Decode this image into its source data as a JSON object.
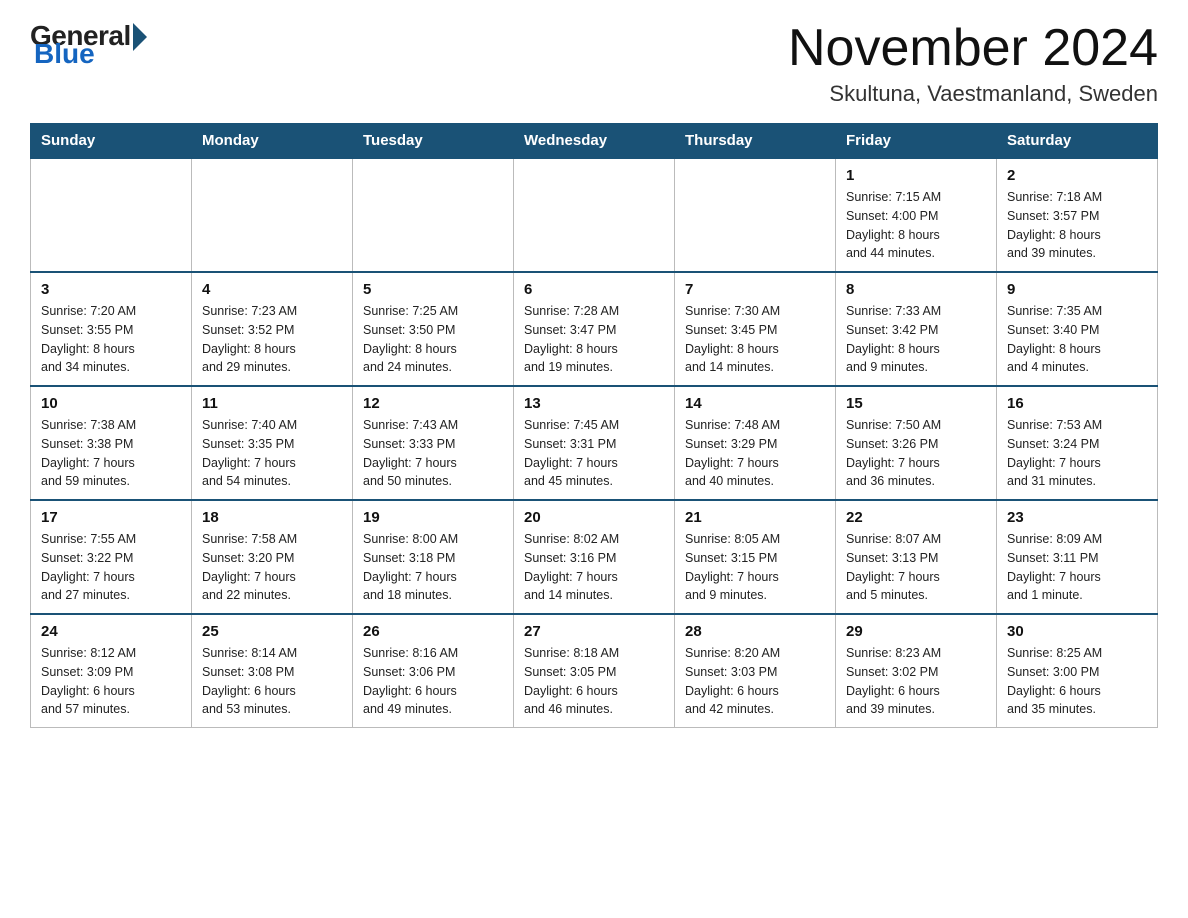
{
  "logo": {
    "general": "General",
    "blue": "Blue"
  },
  "title": "November 2024",
  "subtitle": "Skultuna, Vaestmanland, Sweden",
  "weekdays": [
    "Sunday",
    "Monday",
    "Tuesday",
    "Wednesday",
    "Thursday",
    "Friday",
    "Saturday"
  ],
  "weeks": [
    [
      {
        "day": "",
        "info": ""
      },
      {
        "day": "",
        "info": ""
      },
      {
        "day": "",
        "info": ""
      },
      {
        "day": "",
        "info": ""
      },
      {
        "day": "",
        "info": ""
      },
      {
        "day": "1",
        "info": "Sunrise: 7:15 AM\nSunset: 4:00 PM\nDaylight: 8 hours\nand 44 minutes."
      },
      {
        "day": "2",
        "info": "Sunrise: 7:18 AM\nSunset: 3:57 PM\nDaylight: 8 hours\nand 39 minutes."
      }
    ],
    [
      {
        "day": "3",
        "info": "Sunrise: 7:20 AM\nSunset: 3:55 PM\nDaylight: 8 hours\nand 34 minutes."
      },
      {
        "day": "4",
        "info": "Sunrise: 7:23 AM\nSunset: 3:52 PM\nDaylight: 8 hours\nand 29 minutes."
      },
      {
        "day": "5",
        "info": "Sunrise: 7:25 AM\nSunset: 3:50 PM\nDaylight: 8 hours\nand 24 minutes."
      },
      {
        "day": "6",
        "info": "Sunrise: 7:28 AM\nSunset: 3:47 PM\nDaylight: 8 hours\nand 19 minutes."
      },
      {
        "day": "7",
        "info": "Sunrise: 7:30 AM\nSunset: 3:45 PM\nDaylight: 8 hours\nand 14 minutes."
      },
      {
        "day": "8",
        "info": "Sunrise: 7:33 AM\nSunset: 3:42 PM\nDaylight: 8 hours\nand 9 minutes."
      },
      {
        "day": "9",
        "info": "Sunrise: 7:35 AM\nSunset: 3:40 PM\nDaylight: 8 hours\nand 4 minutes."
      }
    ],
    [
      {
        "day": "10",
        "info": "Sunrise: 7:38 AM\nSunset: 3:38 PM\nDaylight: 7 hours\nand 59 minutes."
      },
      {
        "day": "11",
        "info": "Sunrise: 7:40 AM\nSunset: 3:35 PM\nDaylight: 7 hours\nand 54 minutes."
      },
      {
        "day": "12",
        "info": "Sunrise: 7:43 AM\nSunset: 3:33 PM\nDaylight: 7 hours\nand 50 minutes."
      },
      {
        "day": "13",
        "info": "Sunrise: 7:45 AM\nSunset: 3:31 PM\nDaylight: 7 hours\nand 45 minutes."
      },
      {
        "day": "14",
        "info": "Sunrise: 7:48 AM\nSunset: 3:29 PM\nDaylight: 7 hours\nand 40 minutes."
      },
      {
        "day": "15",
        "info": "Sunrise: 7:50 AM\nSunset: 3:26 PM\nDaylight: 7 hours\nand 36 minutes."
      },
      {
        "day": "16",
        "info": "Sunrise: 7:53 AM\nSunset: 3:24 PM\nDaylight: 7 hours\nand 31 minutes."
      }
    ],
    [
      {
        "day": "17",
        "info": "Sunrise: 7:55 AM\nSunset: 3:22 PM\nDaylight: 7 hours\nand 27 minutes."
      },
      {
        "day": "18",
        "info": "Sunrise: 7:58 AM\nSunset: 3:20 PM\nDaylight: 7 hours\nand 22 minutes."
      },
      {
        "day": "19",
        "info": "Sunrise: 8:00 AM\nSunset: 3:18 PM\nDaylight: 7 hours\nand 18 minutes."
      },
      {
        "day": "20",
        "info": "Sunrise: 8:02 AM\nSunset: 3:16 PM\nDaylight: 7 hours\nand 14 minutes."
      },
      {
        "day": "21",
        "info": "Sunrise: 8:05 AM\nSunset: 3:15 PM\nDaylight: 7 hours\nand 9 minutes."
      },
      {
        "day": "22",
        "info": "Sunrise: 8:07 AM\nSunset: 3:13 PM\nDaylight: 7 hours\nand 5 minutes."
      },
      {
        "day": "23",
        "info": "Sunrise: 8:09 AM\nSunset: 3:11 PM\nDaylight: 7 hours\nand 1 minute."
      }
    ],
    [
      {
        "day": "24",
        "info": "Sunrise: 8:12 AM\nSunset: 3:09 PM\nDaylight: 6 hours\nand 57 minutes."
      },
      {
        "day": "25",
        "info": "Sunrise: 8:14 AM\nSunset: 3:08 PM\nDaylight: 6 hours\nand 53 minutes."
      },
      {
        "day": "26",
        "info": "Sunrise: 8:16 AM\nSunset: 3:06 PM\nDaylight: 6 hours\nand 49 minutes."
      },
      {
        "day": "27",
        "info": "Sunrise: 8:18 AM\nSunset: 3:05 PM\nDaylight: 6 hours\nand 46 minutes."
      },
      {
        "day": "28",
        "info": "Sunrise: 8:20 AM\nSunset: 3:03 PM\nDaylight: 6 hours\nand 42 minutes."
      },
      {
        "day": "29",
        "info": "Sunrise: 8:23 AM\nSunset: 3:02 PM\nDaylight: 6 hours\nand 39 minutes."
      },
      {
        "day": "30",
        "info": "Sunrise: 8:25 AM\nSunset: 3:00 PM\nDaylight: 6 hours\nand 35 minutes."
      }
    ]
  ]
}
